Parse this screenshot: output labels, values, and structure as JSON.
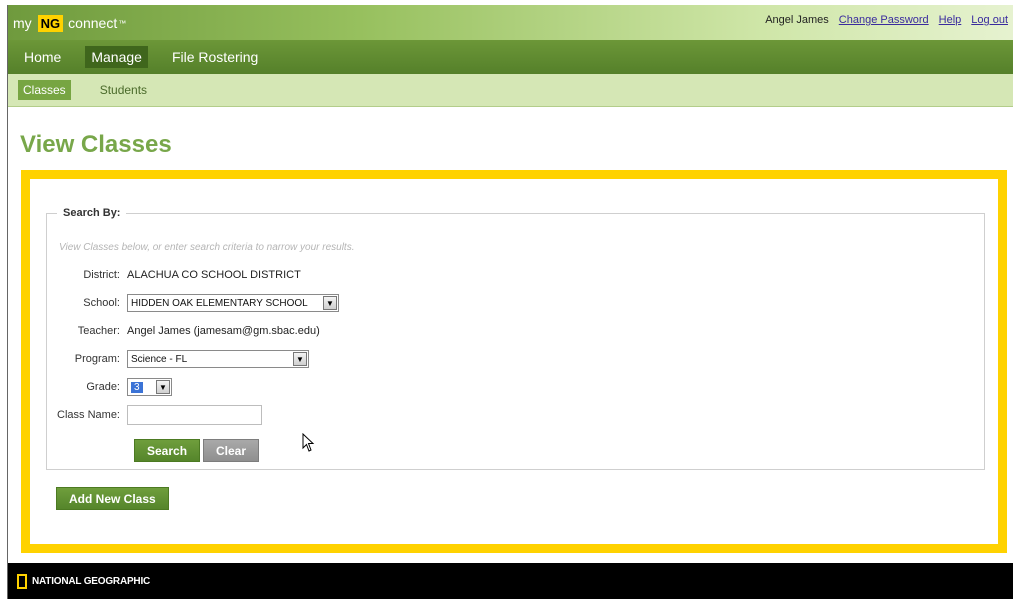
{
  "header": {
    "logo_my": "my",
    "logo_ng": "NG",
    "logo_connect": "connect",
    "logo_tm": "™",
    "user_name": "Angel James",
    "links": [
      "Change Password",
      "Help",
      "Log out"
    ]
  },
  "main_nav": {
    "items": [
      "Home",
      "Manage",
      "File Rostering"
    ],
    "active": "Manage"
  },
  "sub_nav": {
    "items": [
      "Classes",
      "Students"
    ],
    "active": "Classes"
  },
  "page_title": "View Classes",
  "search": {
    "legend": "Search By:",
    "hint": "View Classes below, or enter search criteria to narrow your results.",
    "district_label": "District:",
    "district_value": "ALACHUA CO SCHOOL DISTRICT",
    "school_label": "School:",
    "school_value": "HIDDEN OAK ELEMENTARY SCHOOL",
    "teacher_label": "Teacher:",
    "teacher_value": "Angel James (jamesam@gm.sbac.edu)",
    "program_label": "Program:",
    "program_value": "Science - FL",
    "grade_label": "Grade:",
    "grade_value": "3",
    "class_name_label": "Class Name:",
    "class_name_value": "",
    "search_button": "Search",
    "clear_button": "Clear"
  },
  "add_class_button": "Add New Class",
  "footer": {
    "brand": "NATIONAL GEOGRAPHIC"
  },
  "colors": {
    "accent_green": "#78a74a",
    "nav_green": "#55802a",
    "highlight_yellow": "#ffd200"
  }
}
